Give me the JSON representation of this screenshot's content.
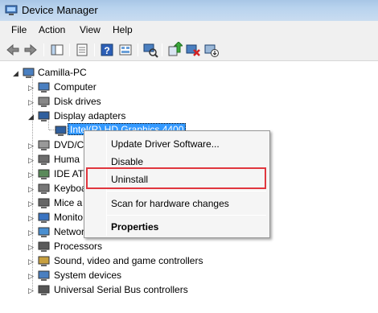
{
  "window": {
    "title": "Device Manager"
  },
  "menubar": {
    "items": [
      "File",
      "Action",
      "View",
      "Help"
    ]
  },
  "toolbar": {
    "buttons": [
      "back-icon",
      "forward-icon",
      "show-hide-console-tree-icon",
      "properties-icon",
      "help-icon",
      "console-icon",
      "scan-hardware-icon",
      "update-driver-icon",
      "uninstall-icon",
      "disable-icon"
    ]
  },
  "tree": {
    "root": "Camilla-PC",
    "items": [
      {
        "label": "Computer",
        "icon": "computer-icon",
        "expanded": false
      },
      {
        "label": "Disk drives",
        "icon": "disk-drive-icon",
        "expanded": false
      },
      {
        "label": "Display adapters",
        "icon": "display-adapter-icon",
        "expanded": true
      },
      {
        "label": "Intel(R) HD Graphics 4400",
        "icon": "display-adapter-icon",
        "child": true,
        "selected": true
      },
      {
        "label": "DVD/C",
        "icon": "dvd-icon",
        "expanded": false
      },
      {
        "label": "Huma",
        "icon": "hid-icon",
        "expanded": false
      },
      {
        "label": "IDE AT",
        "icon": "ide-icon",
        "expanded": false
      },
      {
        "label": "Keyboa",
        "icon": "keyboard-icon",
        "expanded": false
      },
      {
        "label": "Mice a",
        "icon": "mouse-icon",
        "expanded": false
      },
      {
        "label": "Monito",
        "icon": "monitor-icon",
        "expanded": false
      },
      {
        "label": "Networ",
        "icon": "network-icon",
        "expanded": false
      },
      {
        "label": "Processors",
        "icon": "processor-icon",
        "expanded": false
      },
      {
        "label": "Sound, video and game controllers",
        "icon": "sound-icon",
        "expanded": false
      },
      {
        "label": "System devices",
        "icon": "system-device-icon",
        "expanded": false
      },
      {
        "label": "Universal Serial Bus controllers",
        "icon": "usb-icon",
        "expanded": false
      }
    ]
  },
  "context_menu": {
    "items": [
      "Update Driver Software...",
      "Disable",
      "Uninstall",
      "Scan for hardware changes",
      "Properties"
    ],
    "highlighted": "Uninstall"
  },
  "colors": {
    "selection": "#3399ff",
    "highlight_box": "#e0363e"
  }
}
